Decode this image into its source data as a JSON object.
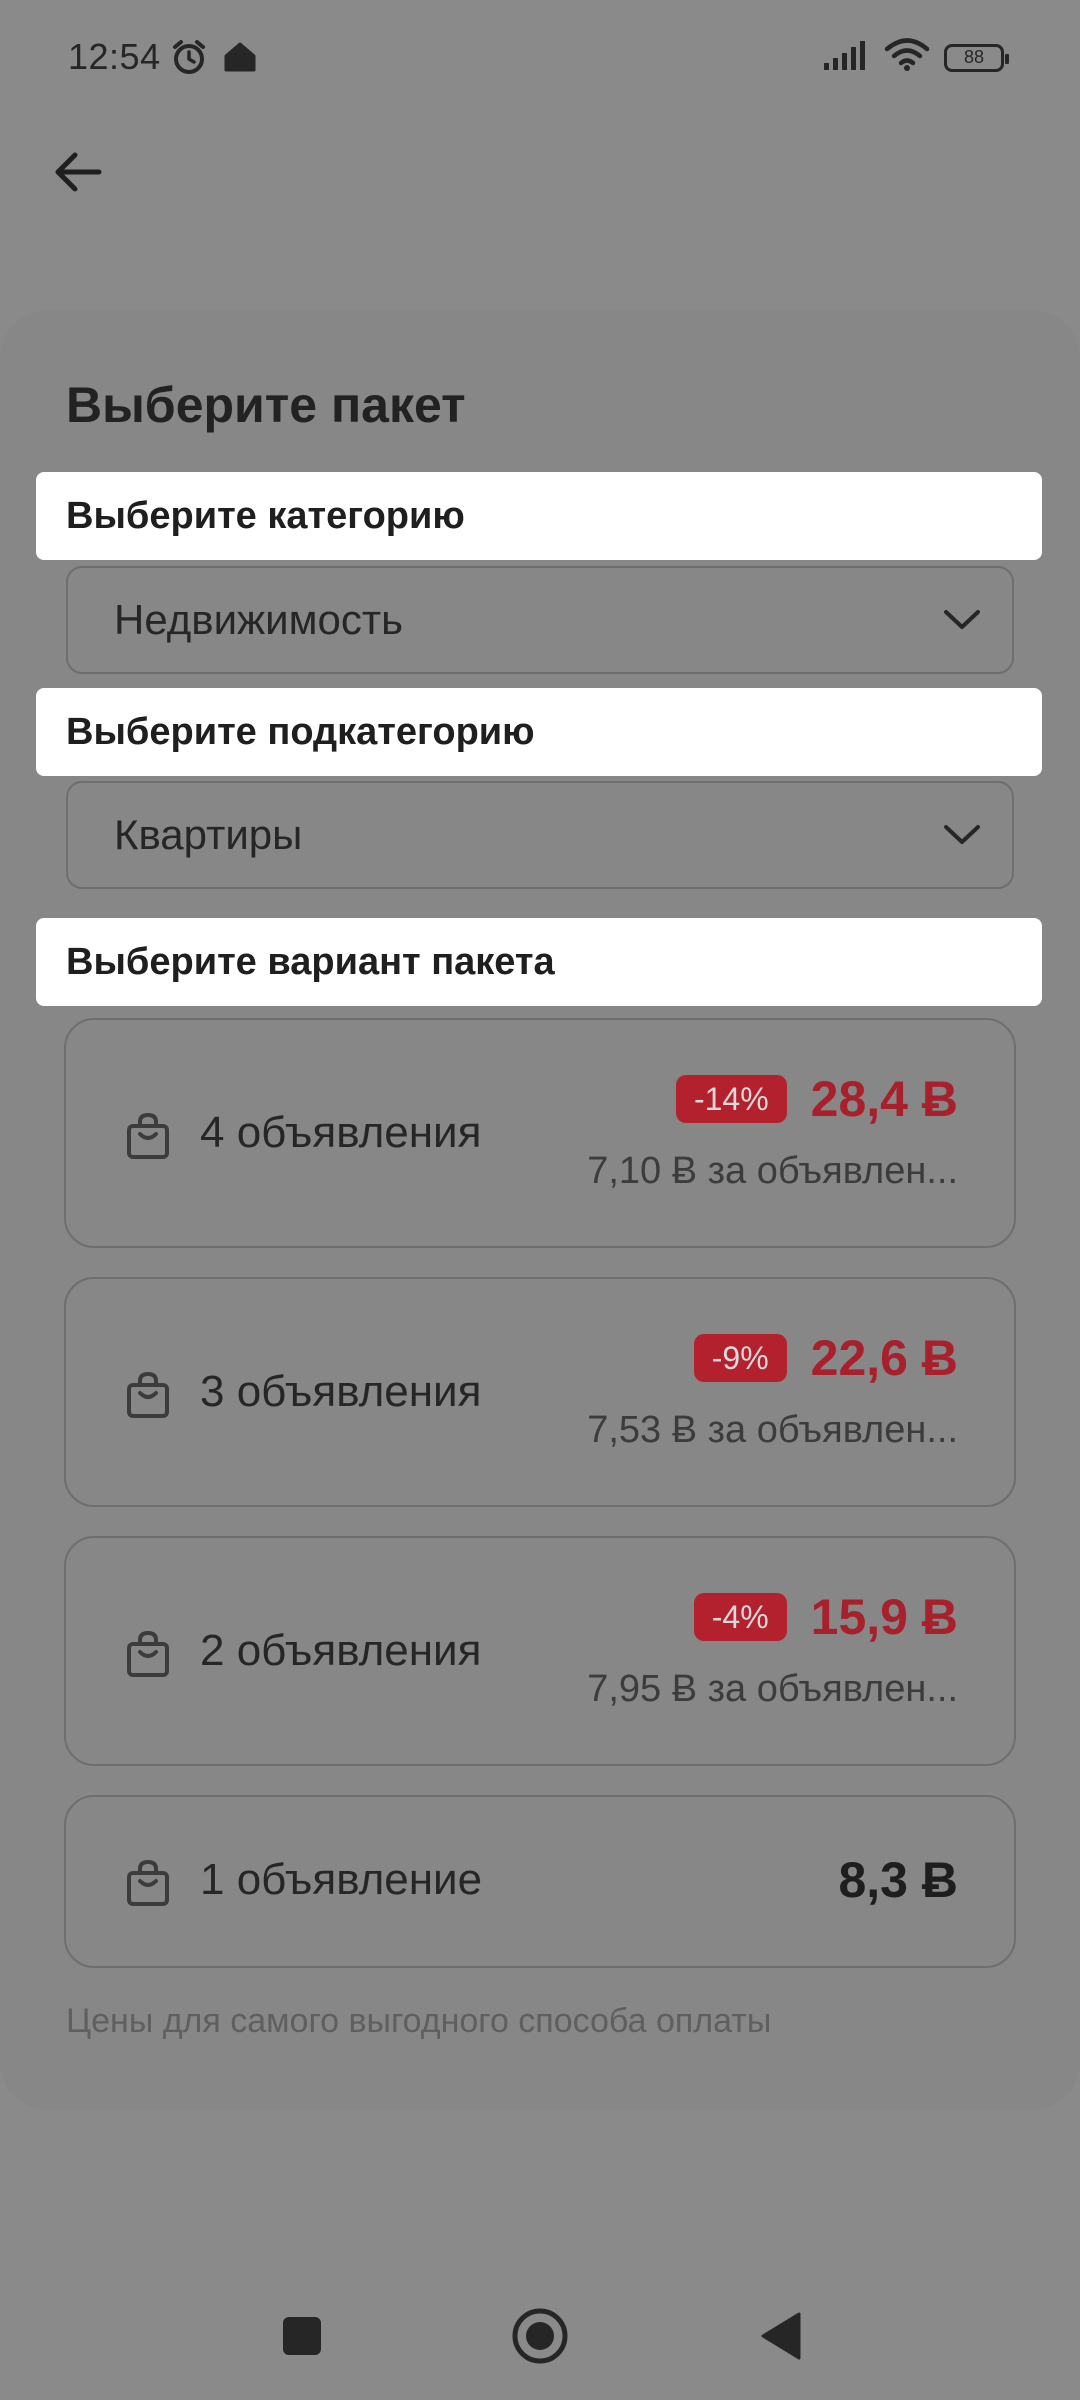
{
  "status_bar": {
    "time": "12:54",
    "battery": "88"
  },
  "page": {
    "title": "Выберите пакет",
    "category_label": "Выберите категорию",
    "category_value": "Недвижимость",
    "subcategory_label": "Выберите подкатегорию",
    "subcategory_value": "Квартиры",
    "variant_label": "Выберите вариант пакета",
    "footer_note": "Цены для самого выгодного способа оплаты"
  },
  "packages": [
    {
      "name": "4 объявления",
      "discount": "-14%",
      "price": "28,4 Ƀ",
      "per_ad": "7,10 Ƀ за объявлен..."
    },
    {
      "name": "3 объявления",
      "discount": "-9%",
      "price": "22,6 Ƀ",
      "per_ad": "7,53 Ƀ за объявлен..."
    },
    {
      "name": "2 объявления",
      "discount": "-4%",
      "price": "15,9 Ƀ",
      "per_ad": "7,95 Ƀ за объявлен..."
    },
    {
      "name": "1 объявление",
      "price": "8,3 Ƀ"
    }
  ],
  "colors": {
    "accent_red": "#b3212e",
    "price_red": "#a8202b",
    "overlay_gray": "#8a8a8a"
  },
  "icons": [
    "back-arrow-icon",
    "alarm-icon",
    "notification-icon",
    "signal-icon",
    "wifi-icon",
    "battery-icon",
    "chevron-down-icon",
    "shopping-bag-icon",
    "nav-recents-icon",
    "nav-home-icon",
    "nav-back-icon"
  ]
}
